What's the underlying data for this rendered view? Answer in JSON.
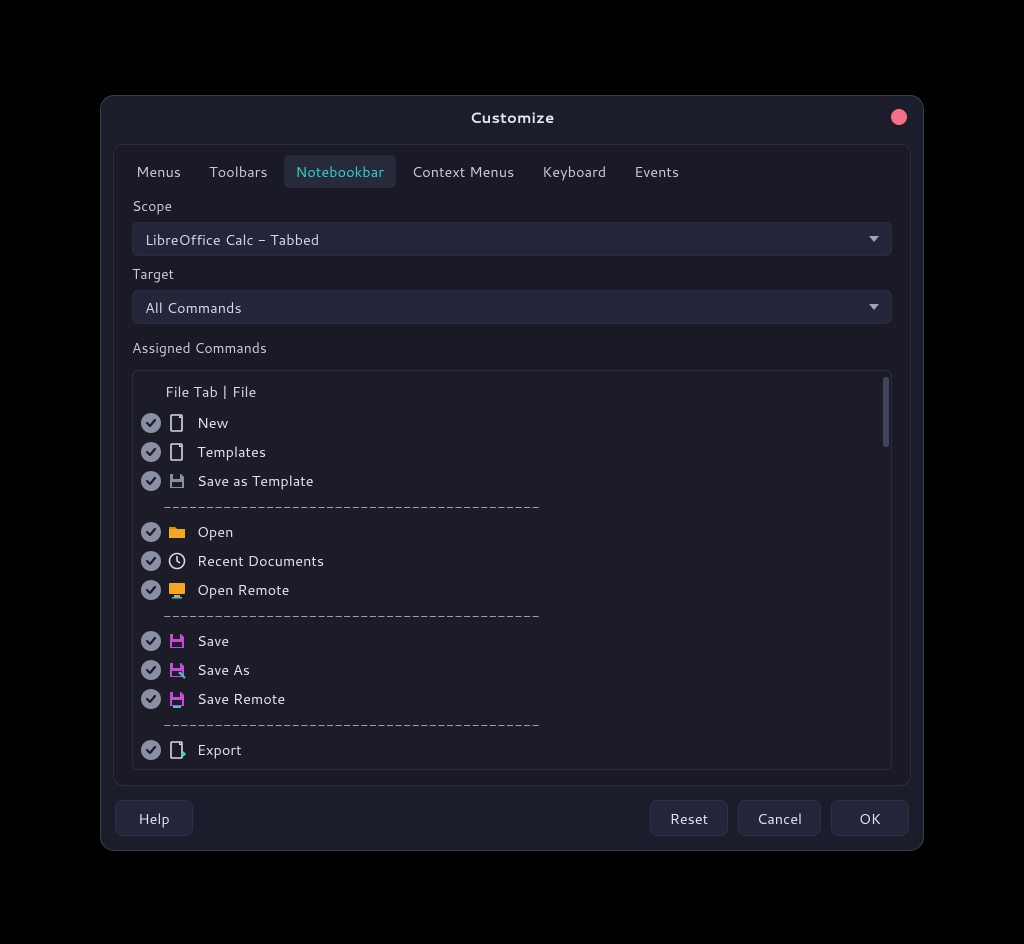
{
  "window": {
    "title": "Customize"
  },
  "tabs": [
    {
      "id": "menus",
      "label": "Menus"
    },
    {
      "id": "toolbars",
      "label": "Toolbars"
    },
    {
      "id": "notebookbar",
      "label": "Notebookbar",
      "active": true
    },
    {
      "id": "contextmenus",
      "label": "Context Menus"
    },
    {
      "id": "keyboard",
      "label": "Keyboard"
    },
    {
      "id": "events",
      "label": "Events"
    }
  ],
  "scope": {
    "label": "Scope",
    "value": "LibreOffice Calc -  Tabbed"
  },
  "target": {
    "label": "Target",
    "value": "All Commands"
  },
  "assigned": {
    "label": "Assigned Commands",
    "group_header": "File Tab | File",
    "separator": "--------------------------------------------",
    "items": [
      {
        "icon": "doc",
        "label": "New"
      },
      {
        "icon": "doc",
        "label": "Templates"
      },
      {
        "icon": "save-grey",
        "label": "Save as Template"
      },
      {
        "sep": true
      },
      {
        "icon": "folder",
        "label": "Open"
      },
      {
        "icon": "clock",
        "label": "Recent Documents"
      },
      {
        "icon": "screen",
        "label": "Open Remote"
      },
      {
        "sep": true
      },
      {
        "icon": "save",
        "label": "Save"
      },
      {
        "icon": "save-as",
        "label": "Save As"
      },
      {
        "icon": "save-remote",
        "label": "Save Remote"
      },
      {
        "sep": true
      },
      {
        "icon": "doc-export",
        "label": "Export"
      }
    ]
  },
  "footer": {
    "help": "Help",
    "reset": "Reset",
    "cancel": "Cancel",
    "ok": "OK"
  }
}
